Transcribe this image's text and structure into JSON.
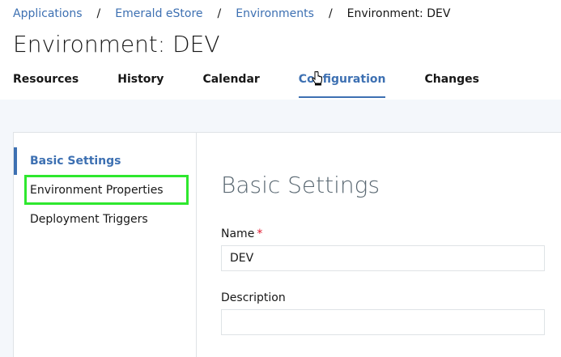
{
  "breadcrumb": {
    "items": [
      "Applications",
      "Emerald eStore",
      "Environments"
    ],
    "separator": "/",
    "current": "Environment: DEV"
  },
  "page": {
    "title": "Environment: DEV"
  },
  "tabs": [
    {
      "label": "Resources",
      "active": false
    },
    {
      "label": "History",
      "active": false
    },
    {
      "label": "Calendar",
      "active": false
    },
    {
      "label": "Configuration",
      "active": true
    },
    {
      "label": "Changes",
      "active": false
    }
  ],
  "sidenav": {
    "items": [
      {
        "label": "Basic Settings",
        "active": true
      },
      {
        "label": "Environment Properties",
        "active": false,
        "highlighted": true
      },
      {
        "label": "Deployment Triggers",
        "active": false
      }
    ]
  },
  "form": {
    "section_title": "Basic Settings",
    "name": {
      "label": "Name",
      "required_mark": "*",
      "value": "DEV"
    },
    "description": {
      "label": "Description",
      "value": ""
    }
  },
  "colors": {
    "link": "#3d70b2",
    "highlight": "#2ee82e",
    "required": "#e0182d"
  },
  "icons": {
    "cursor": "hand-pointer-icon"
  }
}
